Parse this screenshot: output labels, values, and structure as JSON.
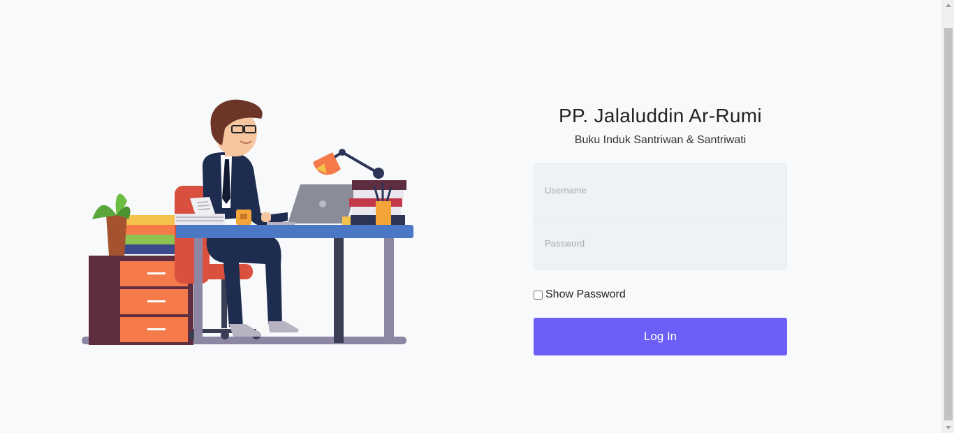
{
  "header": {
    "title": "PP. Jalaluddin Ar-Rumi",
    "subtitle": "Buku Induk Santriwan & Santriwati"
  },
  "form": {
    "username_placeholder": "Username",
    "username_value": "",
    "password_placeholder": "Password",
    "password_value": "",
    "show_password_label": "Show Password",
    "show_password_checked": false,
    "login_label": "Log In"
  },
  "illustration": {
    "icon": "office-worker-at-desk-illustration"
  },
  "colors": {
    "accent": "#6c5ff7",
    "background": "#f8f9fb",
    "field_bg": "#eef2f4",
    "desk": "#4a78c4",
    "drawer": "#f47a4a"
  }
}
